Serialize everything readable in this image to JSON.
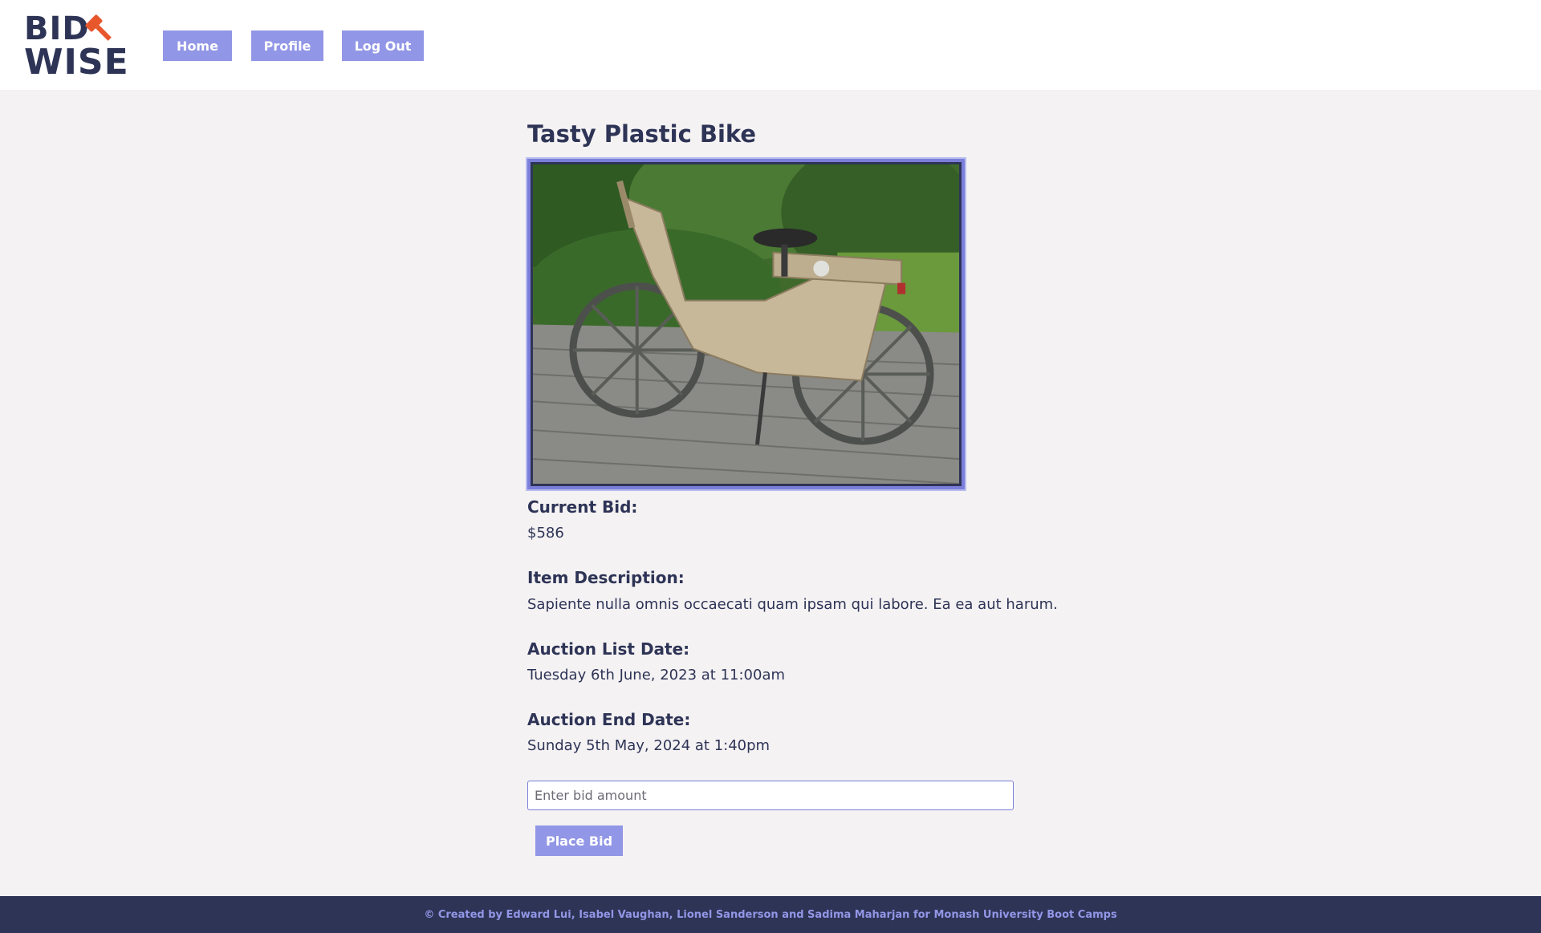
{
  "header": {
    "logo": {
      "line1": "BID",
      "line2": "WISE",
      "icon": "gavel-icon"
    },
    "nav": [
      {
        "label": "Home"
      },
      {
        "label": "Profile"
      },
      {
        "label": "Log Out"
      }
    ]
  },
  "item": {
    "title": "Tasty Plastic Bike",
    "image_icon": "bike-photo",
    "current_bid_label": "Current Bid:",
    "current_bid": "$586",
    "description_label": "Item Description:",
    "description": "Sapiente nulla omnis occaecati quam ipsam qui labore. Ea ea aut harum.",
    "list_date_label": "Auction List Date:",
    "list_date": "Tuesday 6th June, 2023 at 11:00am",
    "end_date_label": "Auction End Date:",
    "end_date": "Sunday 5th May, 2024 at 1:40pm"
  },
  "bid_form": {
    "placeholder": "Enter bid amount",
    "value": "",
    "button_label": "Place Bid"
  },
  "footer": {
    "text": "© Created by Edward Lui, Isabel Vaughan, Lionel Sanderson and Sadima Maharjan for Monash University Boot Camps"
  },
  "colors": {
    "navy": "#2e3456",
    "accent": "#9296e6",
    "orange": "#e8572c",
    "background": "#f4f2f3"
  }
}
